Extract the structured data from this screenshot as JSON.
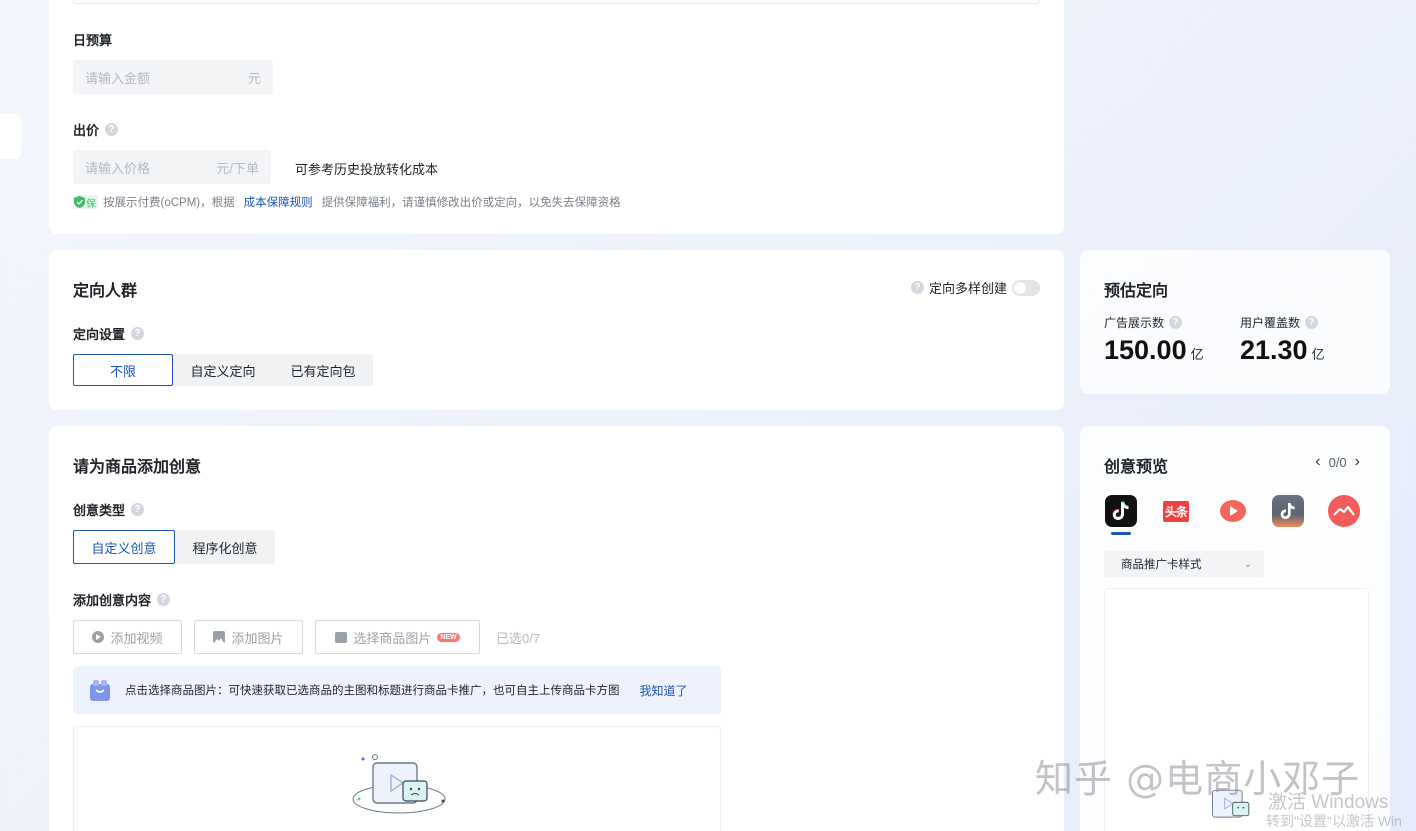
{
  "budget": {
    "daily_label": "日预算",
    "amount_placeholder": "请输入金额",
    "amount_unit": "元",
    "bid_label": "出价",
    "price_placeholder": "请输入价格",
    "price_unit": "元/下单",
    "history_hint": "可参考历史投放转化成本",
    "guarantee_badge": "保",
    "guarantee_text_before": "按展示付费(oCPM)，根据",
    "guarantee_link": "成本保障规则",
    "guarantee_text_after": "提供保障福利，请谨慎修改出价或定向，以免失去保障资格"
  },
  "targeting": {
    "title": "定向人群",
    "multi_create_label": "定向多样创建",
    "settings_label": "定向设置",
    "options": [
      "不限",
      "自定义定向",
      "已有定向包"
    ]
  },
  "estimate": {
    "title": "预估定向",
    "impressions_label": "广告展示数",
    "impressions_value": "150.00",
    "impressions_unit": "亿",
    "coverage_label": "用户覆盖数",
    "coverage_value": "21.30",
    "coverage_unit": "亿"
  },
  "creative": {
    "title": "请为商品添加创意",
    "type_label": "创意类型",
    "type_options": [
      "自定义创意",
      "程序化创意"
    ],
    "add_content_label": "添加创意内容",
    "add_video": "添加视频",
    "add_image": "添加图片",
    "select_product_image": "选择商品图片",
    "new_badge": "NEW",
    "selected_count": "已选0/7",
    "tip_text": "点击选择商品图片：可快速获取已选商品的主图和标题进行商品卡推广，也可自主上传商品卡方图",
    "tip_link": "我知道了"
  },
  "preview": {
    "title": "创意预览",
    "pager": "0/0",
    "style_select": "商品推广卡样式",
    "platforms": [
      "douyin-icon",
      "toutiao-icon",
      "xigua-icon",
      "douyin-lite-icon",
      "huoshan-icon"
    ],
    "toutiao_text": "头条"
  },
  "watermarks": {
    "zhihu": "知乎 @电商小邓子",
    "activate_title": "激活 Windows",
    "activate_sub": "转到\"设置\"以激活 Win"
  },
  "colors": {
    "primary": "#1c55b3",
    "link": "#1c55b3",
    "guarantee_green": "#3fb96b",
    "toutiao_red": "#f04142",
    "douyin_black": "#111111"
  }
}
